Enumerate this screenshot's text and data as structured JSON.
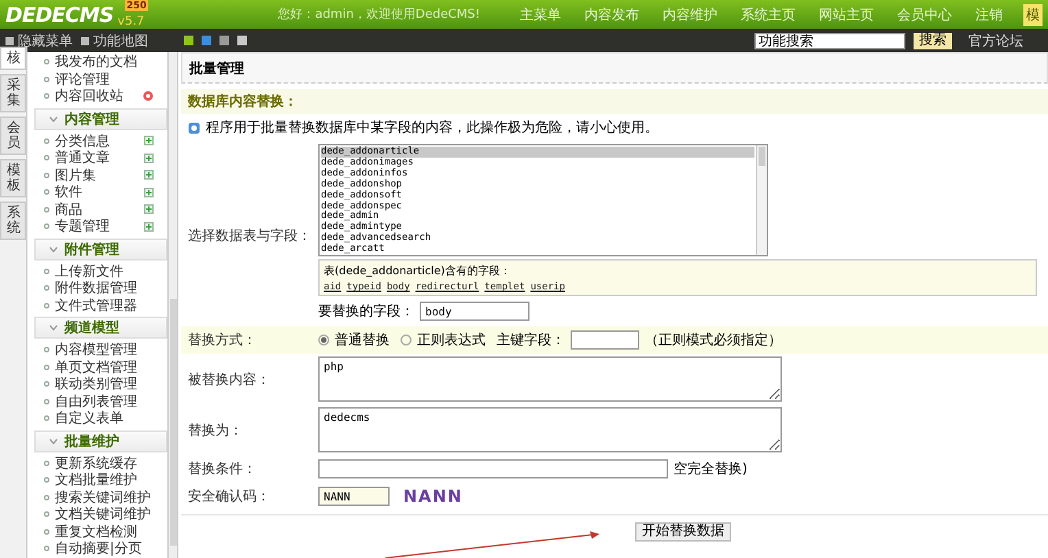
{
  "header": {
    "logo": "DEDECMS",
    "version": "v5.7",
    "badge": "250",
    "greeting": "您好：admin，欢迎使用DedeCMS!",
    "nav": [
      {
        "label": "主菜单",
        "selected": false
      },
      {
        "label": "内容发布",
        "selected": false
      },
      {
        "label": "内容维护",
        "selected": false
      },
      {
        "label": "系统主页",
        "selected": false
      },
      {
        "label": "网站主页",
        "selected": false
      },
      {
        "label": "会员中心",
        "selected": false
      },
      {
        "label": "注销",
        "selected": false
      },
      {
        "label": "模",
        "selected": true
      }
    ]
  },
  "toolbar": {
    "buttons": [
      "隐藏菜单",
      "功能地图"
    ],
    "skins": [
      {
        "color": "#8fc31f"
      },
      {
        "color": "#3a8fd8"
      },
      {
        "color": "#9a9a9a"
      },
      {
        "color": "#c8c8c8"
      }
    ],
    "search": {
      "value": "功能搜索"
    },
    "search_button": "搜索",
    "forum_link": "官方论坛"
  },
  "side_tabs": [
    {
      "label": "核",
      "selected": true
    },
    {
      "label": "采集",
      "selected": false
    },
    {
      "label": "会员",
      "selected": false
    },
    {
      "label": "模板",
      "selected": false
    },
    {
      "label": "系统",
      "selected": false
    }
  ],
  "sidebar": {
    "top_items": [
      {
        "label": "我发布的文档",
        "kind": "plain"
      },
      {
        "label": "评论管理",
        "kind": "plain"
      },
      {
        "label": "内容回收站",
        "kind": "trash"
      }
    ],
    "groups": [
      {
        "title": "内容管理",
        "expanded": true,
        "items": [
          {
            "label": "分类信息",
            "kind": "add"
          },
          {
            "label": "普通文章",
            "kind": "add"
          },
          {
            "label": "图片集",
            "kind": "add"
          },
          {
            "label": "软件",
            "kind": "add"
          },
          {
            "label": "商品",
            "kind": "add"
          },
          {
            "label": "专题管理",
            "kind": "add"
          }
        ]
      },
      {
        "title": "附件管理",
        "expanded": true,
        "items": [
          {
            "label": "上传新文件",
            "kind": "plain"
          },
          {
            "label": "附件数据管理",
            "kind": "plain"
          },
          {
            "label": "文件式管理器",
            "kind": "plain"
          }
        ]
      },
      {
        "title": "频道模型",
        "expanded": true,
        "items": [
          {
            "label": "内容模型管理",
            "kind": "plain"
          },
          {
            "label": "单页文档管理",
            "kind": "plain"
          },
          {
            "label": "联动类别管理",
            "kind": "plain"
          },
          {
            "label": "自由列表管理",
            "kind": "plain"
          },
          {
            "label": "自定义表单",
            "kind": "plain"
          }
        ]
      },
      {
        "title": "批量维护",
        "expanded": true,
        "items": [
          {
            "label": "更新系统缓存",
            "kind": "plain"
          },
          {
            "label": "文档批量维护",
            "kind": "plain"
          },
          {
            "label": "搜索关键词维护",
            "kind": "plain"
          },
          {
            "label": "文档关键词维护",
            "kind": "plain"
          },
          {
            "label": "重复文档检测",
            "kind": "plain"
          },
          {
            "label": "自动摘要|分页",
            "kind": "plain"
          }
        ]
      }
    ]
  },
  "main": {
    "title": "批量管理",
    "section": "数据库内容替换：",
    "note": "程序用于批量替换数据库中某字段的内容，此操作极为危险，请小心使用。",
    "table_label": "选择数据表与字段：",
    "tables": [
      {
        "label": "dede_addonarticle",
        "selected": true
      },
      {
        "label": "dede_addonimages",
        "selected": false
      },
      {
        "label": "dede_addoninfos",
        "selected": false
      },
      {
        "label": "dede_addonshop",
        "selected": false
      },
      {
        "label": "dede_addonsoft",
        "selected": false
      },
      {
        "label": "dede_addonspec",
        "selected": false
      },
      {
        "label": "dede_admin",
        "selected": false
      },
      {
        "label": "dede_admintype",
        "selected": false
      },
      {
        "label": "dede_advancedsearch",
        "selected": false
      },
      {
        "label": "dede_arcatt",
        "selected": false
      }
    ],
    "fields_caption": "表(dede_addonarticle)含有的字段：",
    "fields": [
      "aid",
      "typeid",
      "body",
      "redirecturl",
      "templet",
      "userip"
    ],
    "field_label": "要替换的字段：",
    "field_value": "body",
    "mode_label": "替换方式：",
    "modes": [
      {
        "label": "普通替换",
        "selected": true
      },
      {
        "label": "正则表达式",
        "selected": false
      }
    ],
    "key_label": "主键字段：",
    "key_hint": "（正则模式必须指定）",
    "find_label": "被替换内容：",
    "find_value": "php",
    "replace_label": "替换为：",
    "replace_value": "dedecms",
    "condition_label": "替换条件：",
    "condition_hint": "空完全替换)",
    "code_label": "安全确认码：",
    "code_value": "NANN",
    "captcha": "NANN",
    "submit": "开始替换数据"
  }
}
